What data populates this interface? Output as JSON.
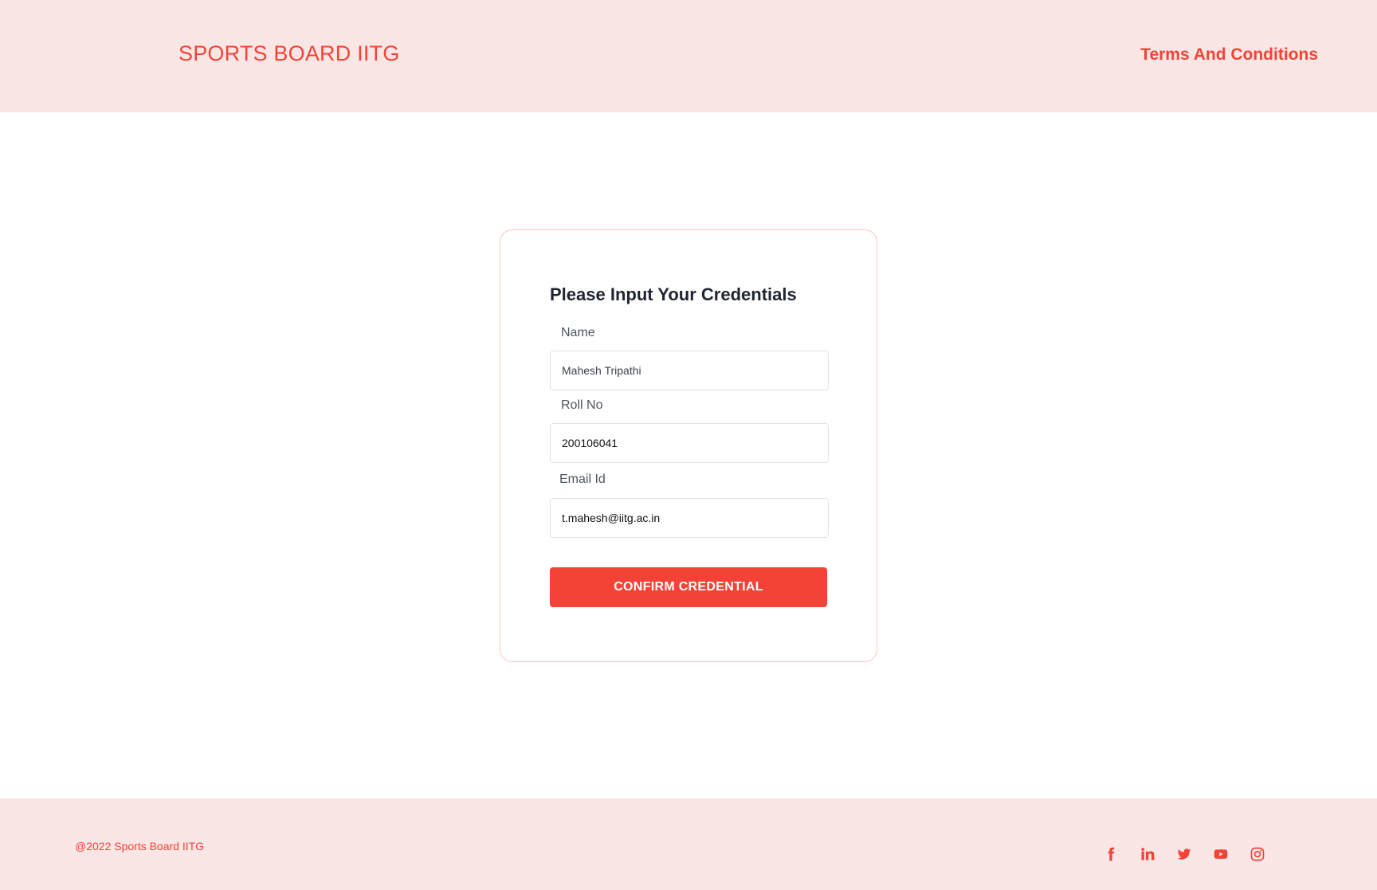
{
  "header": {
    "brand": "SPORTS BOARD IITG",
    "terms_link": "Terms And Conditions"
  },
  "form": {
    "title": "Please Input Your Credentials",
    "name_label": "Name",
    "name_value": "Mahesh Tripathi",
    "roll_label": "Roll No",
    "roll_value": "200106041",
    "email_label": "Email Id",
    "email_value": "t.mahesh@iitg.ac.in",
    "confirm_label": "CONFIRM CREDENTIAL"
  },
  "footer": {
    "copyright": "@2022 Sports Board IITG",
    "social_icons": [
      "facebook-icon",
      "linkedin-icon",
      "twitter-icon",
      "youtube-icon",
      "instagram-icon"
    ]
  },
  "colors": {
    "accent": "#f44336",
    "band_background": "#fbe6e6",
    "card_border": "#f8c8c4"
  }
}
